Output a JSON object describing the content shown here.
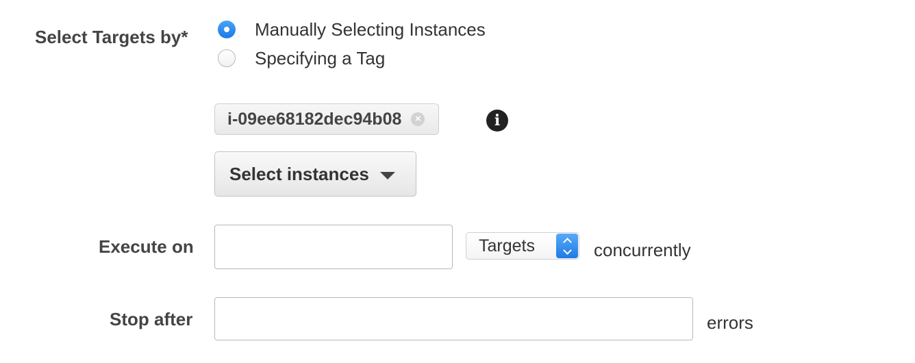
{
  "targets": {
    "label": "Select Targets by*",
    "options": [
      {
        "label": "Manually Selecting Instances",
        "selected": true
      },
      {
        "label": "Specifying a Tag",
        "selected": false
      }
    ],
    "selected_instances": [
      "i-09ee68182dec94b08"
    ],
    "chip_remove_symbol": "×",
    "info_symbol": "i",
    "select_instances_label": "Select instances"
  },
  "execute_on": {
    "label": "Execute on",
    "value": "",
    "unit_value": "Targets",
    "suffix": "concurrently"
  },
  "stop_after": {
    "label": "Stop after",
    "value": "",
    "suffix": "errors"
  },
  "colors": {
    "accent": "#1b7ae6",
    "label_text": "#444444"
  }
}
